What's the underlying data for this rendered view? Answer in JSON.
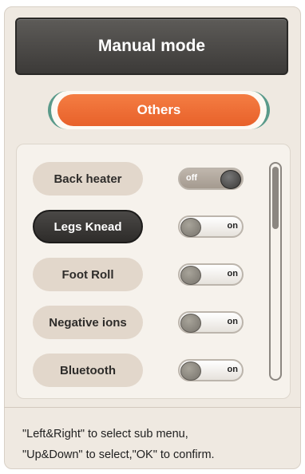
{
  "header": {
    "title": "Manual mode"
  },
  "category": {
    "label": "Others"
  },
  "items": [
    {
      "label": "Back heater",
      "toggle": "off",
      "selected": false
    },
    {
      "label": "Legs Knead",
      "toggle": "on",
      "selected": true
    },
    {
      "label": "Foot Roll",
      "toggle": "on",
      "selected": false
    },
    {
      "label": "Negative ions",
      "toggle": "on",
      "selected": false
    },
    {
      "label": "Bluetooth",
      "toggle": "on",
      "selected": false
    }
  ],
  "hints": {
    "line1": "\"Left&Right\" to select sub menu,",
    "line2": "\"Up&Down\" to select,\"OK\" to confirm."
  },
  "colors": {
    "accent": "#e8612a",
    "header_bg": "#4a4846",
    "panel_bg": "#efe9e1"
  }
}
